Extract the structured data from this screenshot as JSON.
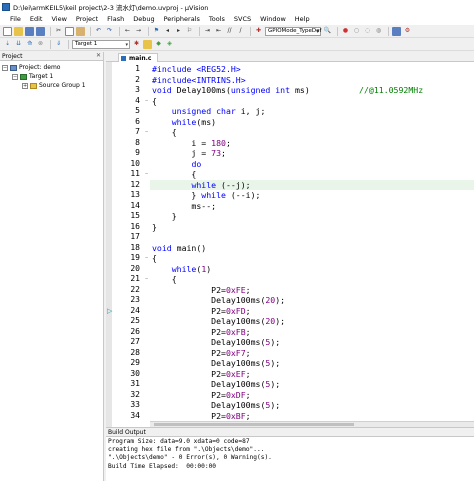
{
  "window": {
    "title": "D:\\lei\\armKEIL5\\keil project\\2-3 流水灯\\demo.uvproj - µVision"
  },
  "menu": [
    "File",
    "Edit",
    "View",
    "Project",
    "Flash",
    "Debug",
    "Peripherals",
    "Tools",
    "SVCS",
    "Window",
    "Help"
  ],
  "toolbar": {
    "find_value": "GPIOMode_TypeDef",
    "target_value": "Target 1"
  },
  "project_panel": {
    "header": "Project",
    "tree": [
      "Project: demo",
      "Target 1",
      "Source Group 1"
    ]
  },
  "editor": {
    "tab": "main.c",
    "lines": [
      [
        [
          "pp",
          "#include <REG52.H>"
        ]
      ],
      [
        [
          "pp",
          "#include<INTRINS.H>"
        ]
      ],
      [
        [
          "kw",
          "void"
        ],
        [
          "plain",
          " Delay100ms("
        ],
        [
          "kw",
          "unsigned int"
        ],
        [
          "plain",
          " ms)          "
        ],
        [
          "cm",
          "//@11.0592MHz"
        ]
      ],
      [
        [
          "plain",
          "{"
        ]
      ],
      [
        [
          "plain",
          "    "
        ],
        [
          "kw",
          "unsigned char"
        ],
        [
          "plain",
          " i, j;"
        ]
      ],
      [
        [
          "plain",
          "    "
        ],
        [
          "kw",
          "while"
        ],
        [
          "plain",
          "(ms)"
        ]
      ],
      [
        [
          "plain",
          "    {"
        ]
      ],
      [
        [
          "plain",
          "        i = "
        ],
        [
          "num",
          "180"
        ],
        [
          "plain",
          ";"
        ]
      ],
      [
        [
          "plain",
          "        j = "
        ],
        [
          "num",
          "73"
        ],
        [
          "plain",
          ";"
        ]
      ],
      [
        [
          "plain",
          "        "
        ],
        [
          "kw",
          "do"
        ]
      ],
      [
        [
          "plain",
          "        {"
        ]
      ],
      [
        [
          "plain",
          "        "
        ],
        [
          "kw",
          "while"
        ],
        [
          "plain",
          " (--j);"
        ]
      ],
      [
        [
          "plain",
          "        } "
        ],
        [
          "kw",
          "while"
        ],
        [
          "plain",
          " (--i);"
        ]
      ],
      [
        [
          "plain",
          "        ms--;"
        ]
      ],
      [
        [
          "plain",
          "    }"
        ]
      ],
      [
        [
          "plain",
          "}"
        ]
      ],
      [
        [
          "plain",
          ""
        ]
      ],
      [
        [
          "kw",
          "void"
        ],
        [
          "plain",
          " main()"
        ]
      ],
      [
        [
          "plain",
          "{"
        ]
      ],
      [
        [
          "plain",
          "    "
        ],
        [
          "kw",
          "while"
        ],
        [
          "plain",
          "("
        ],
        [
          "num",
          "1"
        ],
        [
          "plain",
          ")"
        ]
      ],
      [
        [
          "plain",
          "    {"
        ]
      ],
      [
        [
          "plain",
          "            P2="
        ],
        [
          "num",
          "0xFE"
        ],
        [
          "plain",
          ";"
        ]
      ],
      [
        [
          "plain",
          "            Delay100ms("
        ],
        [
          "num",
          "20"
        ],
        [
          "plain",
          ");"
        ]
      ],
      [
        [
          "plain",
          "            P2="
        ],
        [
          "num",
          "0xFD"
        ],
        [
          "plain",
          ";"
        ]
      ],
      [
        [
          "plain",
          "            Delay100ms("
        ],
        [
          "num",
          "20"
        ],
        [
          "plain",
          ");"
        ]
      ],
      [
        [
          "plain",
          "            P2="
        ],
        [
          "num",
          "0xFB"
        ],
        [
          "plain",
          ";"
        ]
      ],
      [
        [
          "plain",
          "            Delay100ms("
        ],
        [
          "num",
          "5"
        ],
        [
          "plain",
          ");"
        ]
      ],
      [
        [
          "plain",
          "            P2="
        ],
        [
          "num",
          "0xF7"
        ],
        [
          "plain",
          ";"
        ]
      ],
      [
        [
          "plain",
          "            Delay100ms("
        ],
        [
          "num",
          "5"
        ],
        [
          "plain",
          ");"
        ]
      ],
      [
        [
          "plain",
          "            P2="
        ],
        [
          "num",
          "0xEF"
        ],
        [
          "plain",
          ";"
        ]
      ],
      [
        [
          "plain",
          "            Delay100ms("
        ],
        [
          "num",
          "5"
        ],
        [
          "plain",
          ");"
        ]
      ],
      [
        [
          "plain",
          "            P2="
        ],
        [
          "num",
          "0xDF"
        ],
        [
          "plain",
          ";"
        ]
      ],
      [
        [
          "plain",
          "            Delay100ms("
        ],
        [
          "num",
          "5"
        ],
        [
          "plain",
          ");"
        ]
      ],
      [
        [
          "plain",
          "            P2="
        ],
        [
          "num",
          "0xBF"
        ],
        [
          "plain",
          ";"
        ]
      ]
    ],
    "current_line": 12,
    "exec_marker_line": 24
  },
  "build_output": {
    "header": "Build Output",
    "lines": [
      "Program Size: data=9.0 xdata=0 code=87",
      "creating hex file from \".\\Objects\\demo\"...",
      "\".\\Objects\\demo\" - 0 Error(s), 0 Warning(s).",
      "Build Time Elapsed:  00:00:00"
    ]
  },
  "colors": {
    "keyword": "#0000ff",
    "number": "#800080",
    "comment": "#008000",
    "highlight": "#e8f5e8"
  }
}
